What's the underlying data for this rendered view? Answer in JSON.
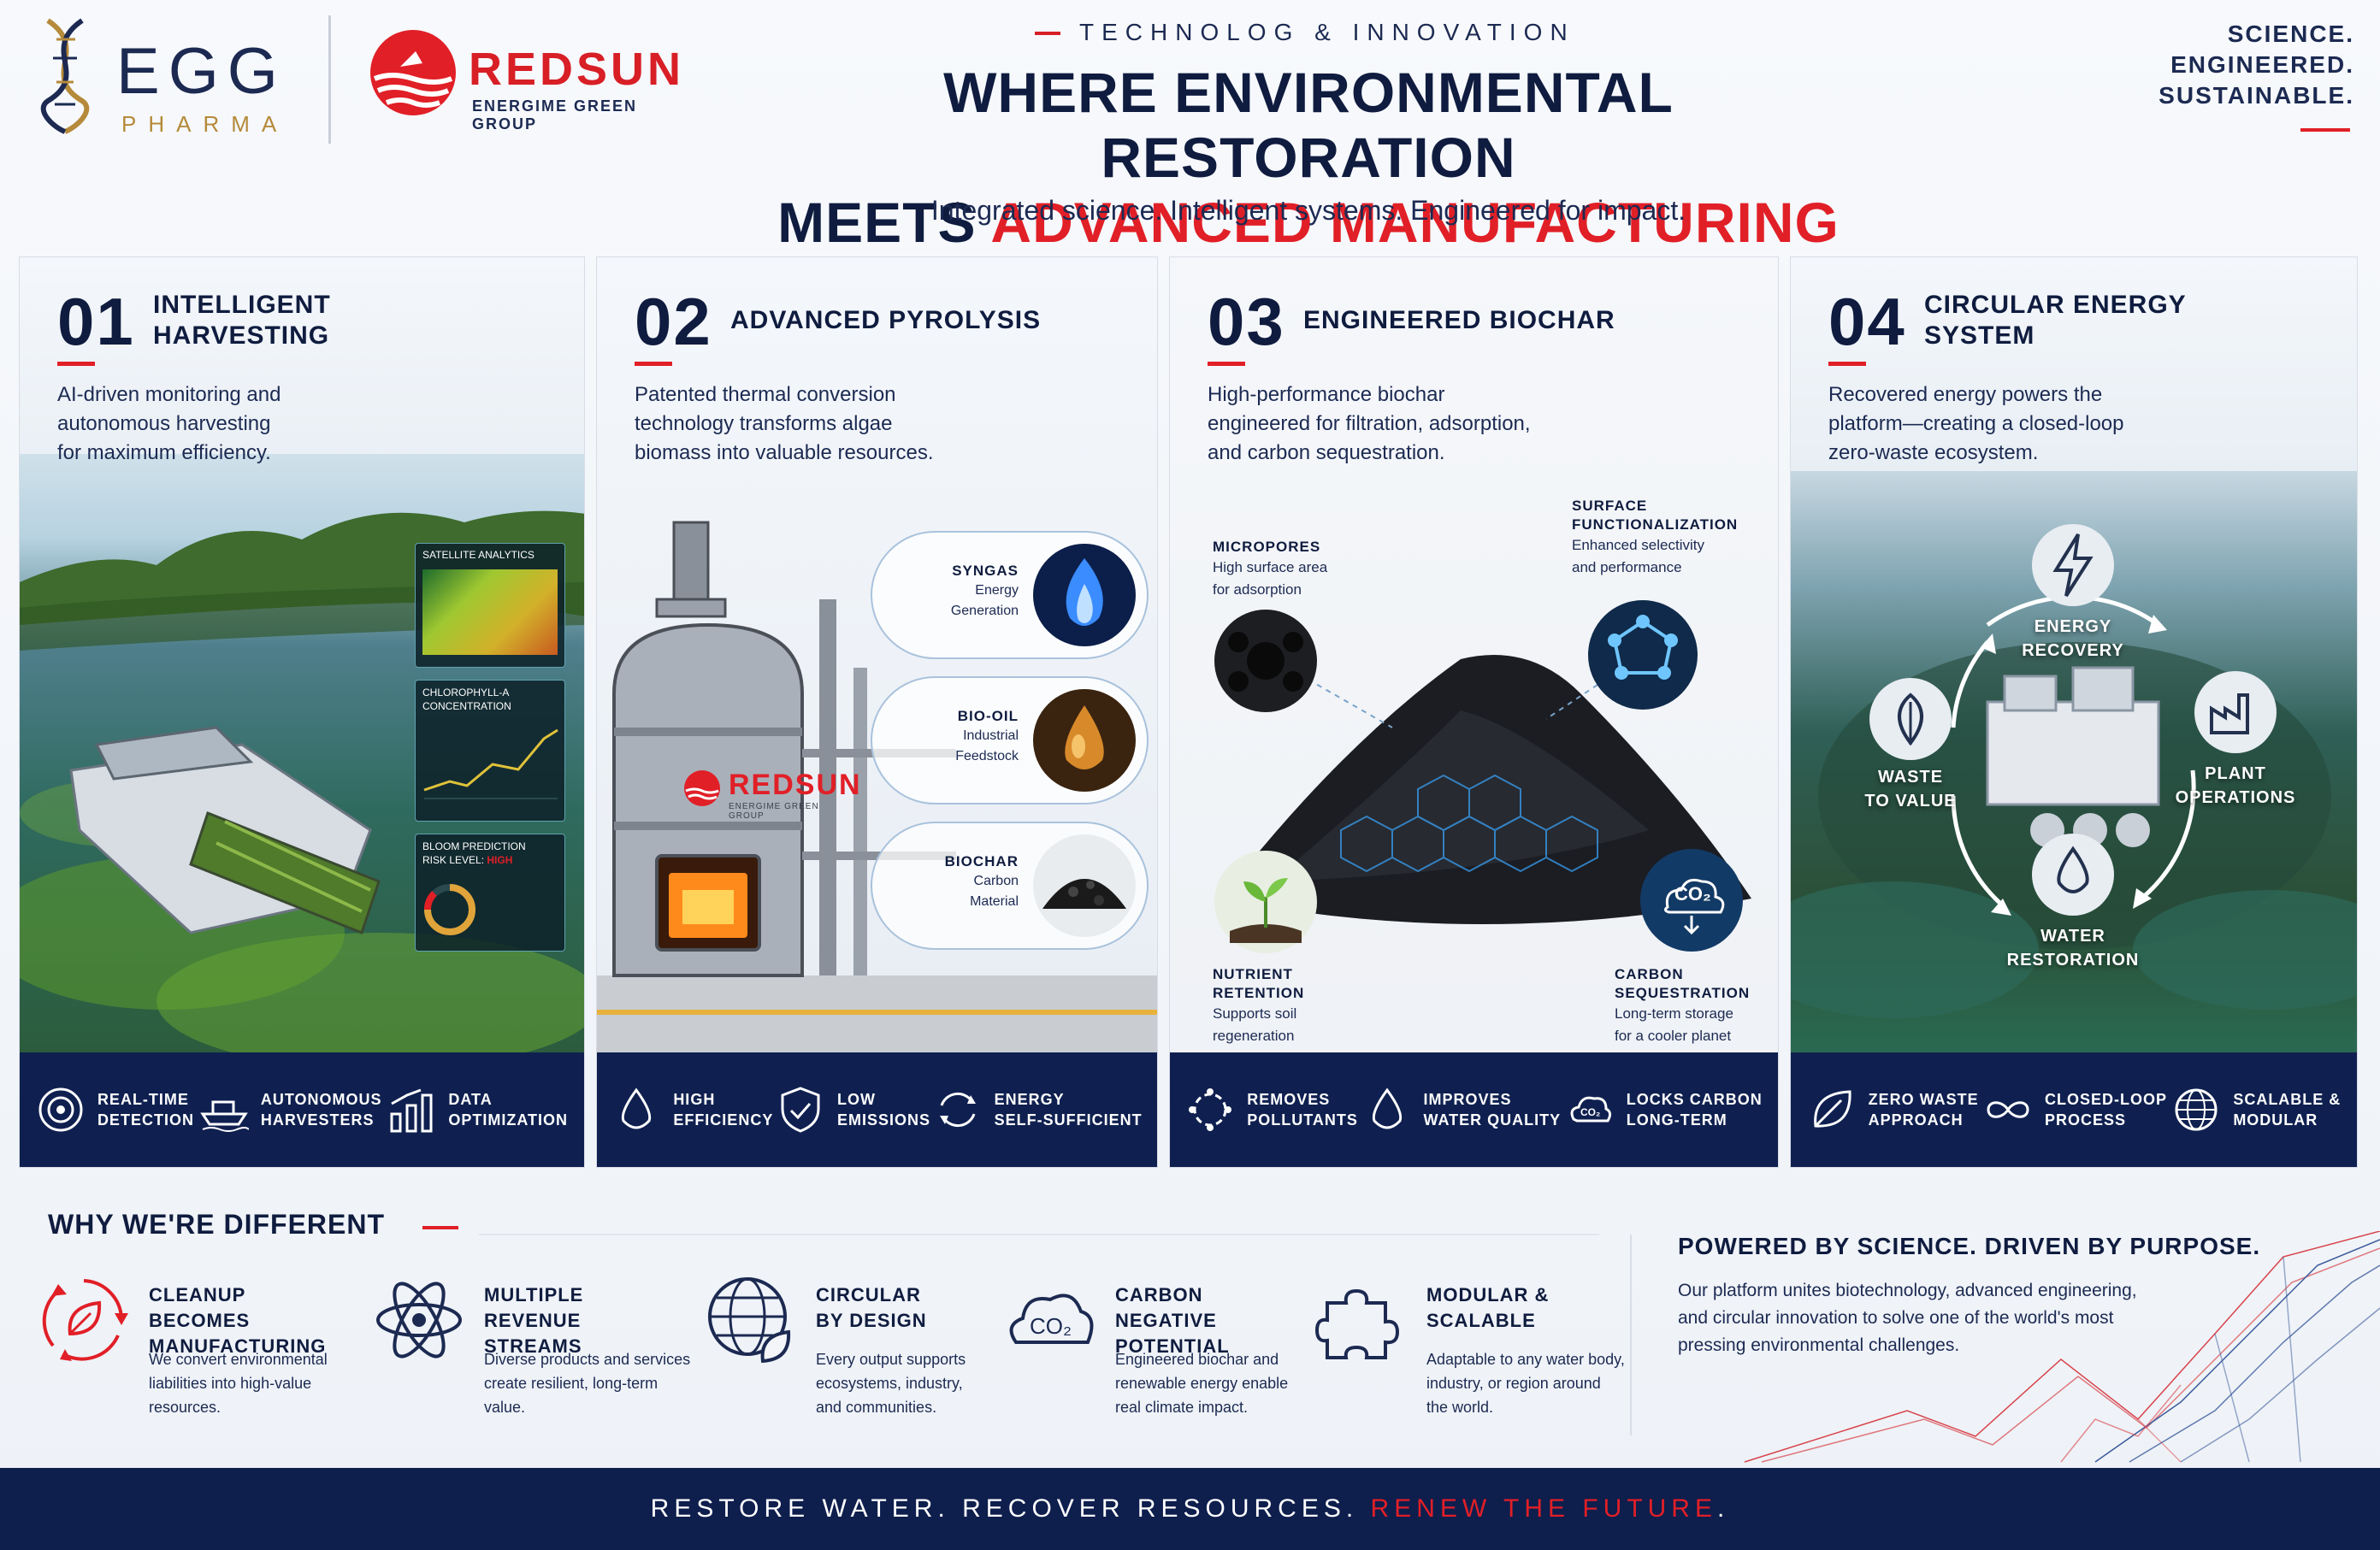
{
  "header": {
    "egg_logo": {
      "word": "EGG",
      "sub": "PHARMA"
    },
    "redsun_logo": {
      "word": "REDSUN",
      "sub": "ENERGIME GREEN GROUP"
    },
    "eyebrow": "TECHNOLOG & INNOVATION",
    "headline_line1": "WHERE ENVIRONMENTAL RESTORATION",
    "headline_line2_prefix": "MEETS ",
    "headline_line2_highlight": "ADVANCED MANUFACTURING",
    "subtitle": "Integrated science. Intelligent systems. Engineered for impact.",
    "tagline": [
      "SCIENCE.",
      "ENGINEERED.",
      "SUSTAINABLE."
    ]
  },
  "panels": [
    {
      "number": "01",
      "title_lines": [
        "INTELLIGENT",
        "HARVESTING"
      ],
      "description_lines": [
        "AI-driven monitoring and",
        "autonomous harvesting",
        "for maximum efficiency."
      ],
      "overlays": {
        "satellite": "SATELLITE ANALYTICS",
        "chlorophyll_line1": "CHLOROPHYLL-A",
        "chlorophyll_line2": "CONCENTRATION",
        "bloom_line1": "BLOOM PREDICTION",
        "bloom_line2_prefix": "RISK LEVEL: ",
        "bloom_level": "HIGH"
      },
      "features": [
        {
          "icon": "target-icon",
          "label": "REAL-TIME\nDETECTION"
        },
        {
          "icon": "boat-icon",
          "label": "AUTONOMOUS\nHARVESTERS"
        },
        {
          "icon": "bar-chart-icon",
          "label": "DATA\nOPTIMIZATION"
        }
      ]
    },
    {
      "number": "02",
      "title_lines": [
        "ADVANCED PYROLYSIS"
      ],
      "description_lines": [
        "Patented thermal conversion",
        "technology transforms algae",
        "biomass into valuable resources."
      ],
      "reactor_brand": "REDSUN",
      "reactor_sub": "ENERGIME GREEN GROUP",
      "outputs": [
        {
          "name": "SYNGAS",
          "lines": [
            "Energy",
            "Generation"
          ],
          "icon": "flame-icon"
        },
        {
          "name": "BIO-OIL",
          "lines": [
            "Industrial",
            "Feedstock"
          ],
          "icon": "oil-drop-icon"
        },
        {
          "name": "BIOCHAR",
          "lines": [
            "Carbon",
            "Material"
          ],
          "icon": "biochar-icon"
        }
      ],
      "features": [
        {
          "icon": "drop-icon",
          "label": "HIGH\nEFFICIENCY"
        },
        {
          "icon": "shield-check-icon",
          "label": "LOW\nEMISSIONS"
        },
        {
          "icon": "cycle-icon",
          "label": "ENERGY\nSELF-SUFFICIENT"
        }
      ]
    },
    {
      "number": "03",
      "title_lines": [
        "ENGINEERED BIOCHAR"
      ],
      "description_lines": [
        "High-performance biochar",
        "engineered for filtration, adsorption,",
        "and carbon sequestration."
      ],
      "callouts": [
        {
          "id": "micropores",
          "title_lines": [
            "MICROPORES"
          ],
          "text_lines": [
            "High surface area",
            "for adsorption"
          ]
        },
        {
          "id": "surface",
          "title_lines": [
            "SURFACE",
            "FUNCTIONALIZATION"
          ],
          "text_lines": [
            "Enhanced selectivity",
            "and performance"
          ]
        },
        {
          "id": "nutrient",
          "title_lines": [
            "NUTRIENT",
            "RETENTION"
          ],
          "text_lines": [
            "Supports soil",
            "regeneration"
          ]
        },
        {
          "id": "carbon",
          "title_lines": [
            "CARBON",
            "SEQUESTRATION"
          ],
          "text_lines": [
            "Long-term storage",
            "for a cooler planet"
          ]
        }
      ],
      "co2_label": "CO₂",
      "features": [
        {
          "icon": "pollutant-icon",
          "label": "REMOVES\nPOLLUTANTS"
        },
        {
          "icon": "drop-icon",
          "label": "IMPROVES\nWATER QUALITY"
        },
        {
          "icon": "co2-cloud-icon",
          "label": "LOCKS CARBON\nLONG-TERM"
        }
      ]
    },
    {
      "number": "04",
      "title_lines": [
        "CIRCULAR ENERGY",
        "SYSTEM"
      ],
      "description_lines": [
        "Recovered energy powers the",
        "platform—creating a closed-loop",
        "zero-waste ecosystem."
      ],
      "cycle": [
        {
          "id": "energy",
          "label_lines": [
            "ENERGY",
            "RECOVERY"
          ],
          "icon": "lightning-icon"
        },
        {
          "id": "plant",
          "label_lines": [
            "PLANT",
            "OPERATIONS"
          ],
          "icon": "factory-icon"
        },
        {
          "id": "water",
          "label_lines": [
            "WATER",
            "RESTORATION"
          ],
          "icon": "water-drop-icon"
        },
        {
          "id": "waste",
          "label_lines": [
            "WASTE",
            "TO VALUE"
          ],
          "icon": "leaf-icon"
        }
      ],
      "features": [
        {
          "icon": "leaf-icon",
          "label": "ZERO WASTE\nAPPROACH"
        },
        {
          "icon": "infinity-icon",
          "label": "CLOSED-LOOP\nPROCESS"
        },
        {
          "icon": "globe-icon",
          "label": "SCALABLE &\nMODULAR"
        }
      ]
    }
  ],
  "why": {
    "title": "WHY WE'RE DIFFERENT",
    "items": [
      {
        "icon": "recycle-leaf-icon",
        "title": "CLEANUP BECOMES\nMANUFACTURING",
        "text_lines": [
          "We convert environmental",
          "liabilities into high-value",
          "resources."
        ]
      },
      {
        "icon": "atom-icon",
        "title": "MULTIPLE REVENUE\nSTREAMS",
        "text_lines": [
          "Diverse products and services",
          "create resilient, long-term",
          "value."
        ]
      },
      {
        "icon": "globe-leaf-icon",
        "title": "CIRCULAR\nBY DESIGN",
        "text_lines": [
          "Every output supports",
          "ecosystems, industry,",
          "and communities."
        ]
      },
      {
        "icon": "co2-cloud-icon",
        "title": "CARBON NEGATIVE\nPOTENTIAL",
        "text_lines": [
          "Engineered biochar and",
          "renewable energy enable",
          "real climate impact."
        ]
      },
      {
        "icon": "puzzle-icon",
        "title": "MODULAR &\nSCALABLE",
        "text_lines": [
          "Adaptable to any water body,",
          "industry, or region around",
          "the world."
        ]
      }
    ]
  },
  "powered": {
    "title": "POWERED BY SCIENCE. DRIVEN BY PURPOSE.",
    "text_lines": [
      "Our platform unites biotechnology, advanced engineering,",
      "and circular innovation to solve one of the world's most",
      "pressing environmental challenges."
    ]
  },
  "footer": {
    "prefix": "RESTORE WATER. RECOVER RESOURCES. ",
    "highlight": "RENEW THE FUTURE",
    "suffix": "."
  },
  "colors": {
    "navy": "#0f2050",
    "red": "#e11f27",
    "gold": "#b58a3a"
  }
}
